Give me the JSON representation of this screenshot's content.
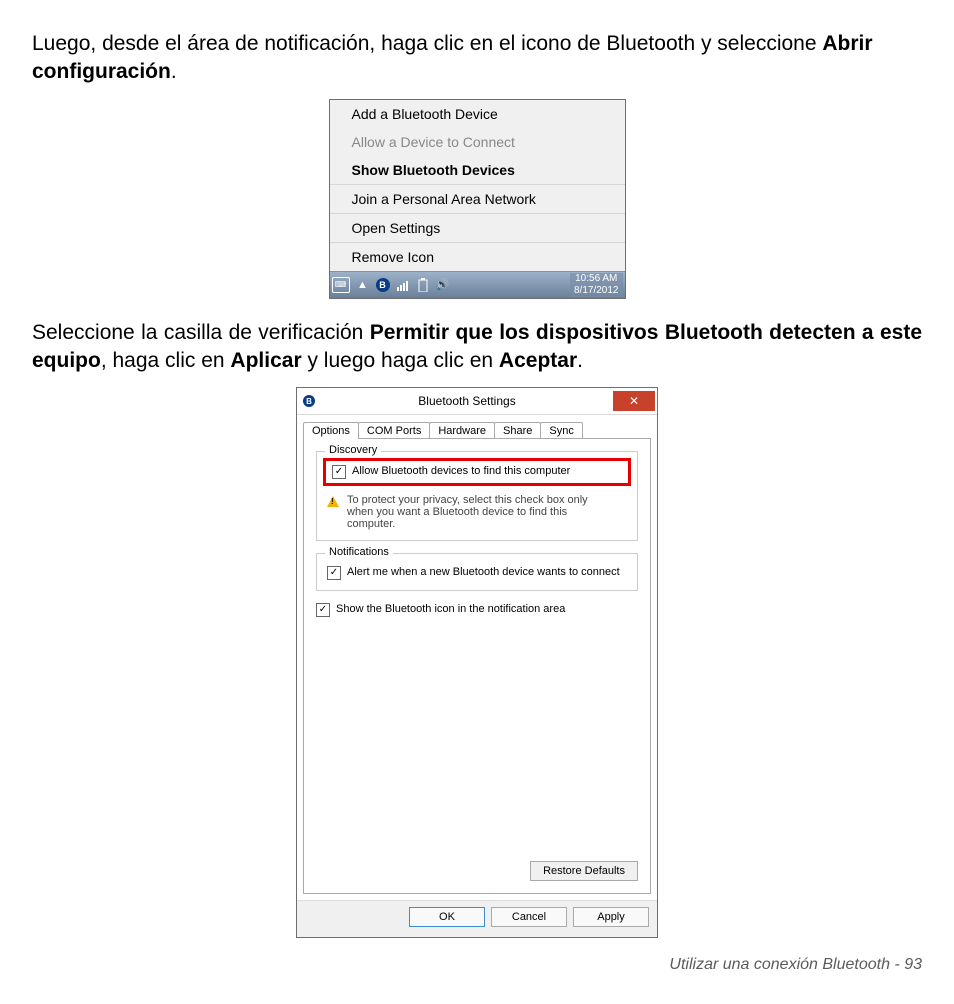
{
  "para1": {
    "pre": "Luego, desde el área de notificación, haga clic en el icono de Bluetooth y seleccione ",
    "bold": "Abrir configuración",
    "post": "."
  },
  "menu": {
    "items": [
      {
        "label": "Add a Bluetooth Device",
        "style": "normal"
      },
      {
        "label": "Allow a Device to Connect",
        "style": "disabled"
      },
      {
        "label": "Show Bluetooth Devices",
        "style": "bold"
      },
      {
        "label": "Join a Personal Area Network",
        "style": "normal"
      },
      {
        "label": "Open Settings",
        "style": "normal"
      },
      {
        "label": "Remove Icon",
        "style": "normal"
      }
    ],
    "taskbar": {
      "time": "10:56 AM",
      "date": "8/17/2012"
    }
  },
  "para2": {
    "t1": "Seleccione la casilla de verificación ",
    "b1": "Permitir que los dispositivos Bluetooth detecten a este equipo",
    "t2": ", haga clic en ",
    "b2": "Aplicar",
    "t3": " y luego haga clic en ",
    "b3": "Aceptar",
    "t4": "."
  },
  "dialog": {
    "title": "Bluetooth Settings",
    "tabs": [
      "Options",
      "COM Ports",
      "Hardware",
      "Share",
      "Sync"
    ],
    "discovery": {
      "legend": "Discovery",
      "checkbox": "Allow Bluetooth devices to find this computer",
      "note": "To protect your privacy, select this check box only when you want a Bluetooth device to find this computer."
    },
    "notifications": {
      "legend": "Notifications",
      "checkbox": "Alert me when a new Bluetooth device wants to connect"
    },
    "showIcon": "Show the Bluetooth icon in the notification area",
    "restore": "Restore Defaults",
    "ok": "OK",
    "cancel": "Cancel",
    "apply": "Apply"
  },
  "footer": {
    "text": "Utilizar una conexión Bluetooth -  93"
  }
}
